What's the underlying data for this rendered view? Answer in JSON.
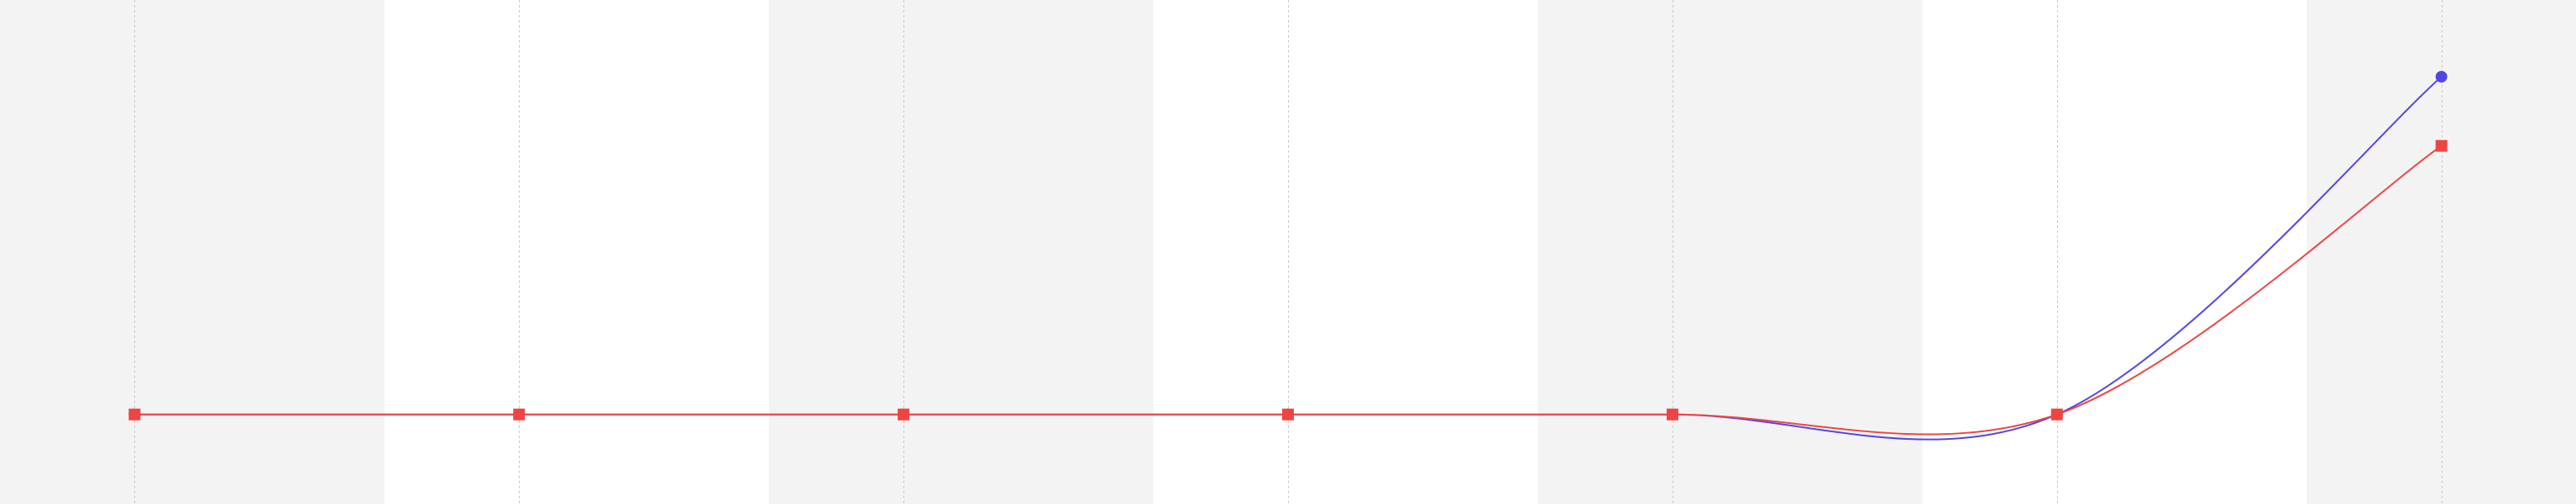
{
  "chart_data": {
    "type": "line",
    "title": "",
    "xlabel": "",
    "ylabel": "",
    "x": [
      0,
      1,
      2,
      3,
      4,
      5,
      6
    ],
    "xlim": [
      -0.35,
      6.35
    ],
    "ylim": [
      -0.35,
      1.62
    ],
    "grid": "vertical dashed",
    "band_colors": [
      "#f3f3f3",
      "#ffffff"
    ],
    "series": [
      {
        "color": "#4f46e5",
        "marker": "circle",
        "values": [
          0,
          0,
          0,
          0,
          0,
          0,
          1.32
        ]
      },
      {
        "color": "#ef4444",
        "marker": "square",
        "values": [
          0,
          0,
          0,
          0,
          0,
          0,
          1.05
        ]
      }
    ]
  }
}
